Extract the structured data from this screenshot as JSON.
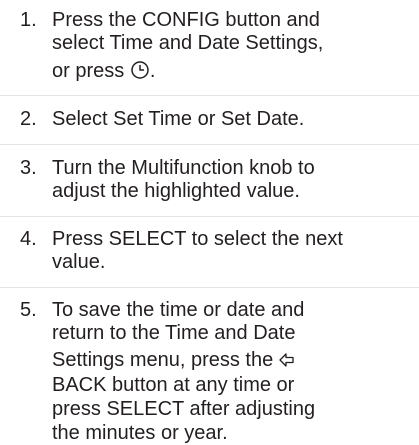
{
  "steps": [
    {
      "number": "1.",
      "line1": "Press the CONFIG button and",
      "line2": "select Time and Date Settings,",
      "line3_prefix": "or press ",
      "line3_suffix": ".",
      "icon": "clock-icon"
    },
    {
      "number": "2.",
      "line1": "Select Set Time or Set Date."
    },
    {
      "number": "3.",
      "line1": "Turn the Multifunction knob to",
      "line2": "adjust the highlighted value."
    },
    {
      "number": "4.",
      "line1": "Press SELECT to select the next",
      "line2": "value."
    },
    {
      "number": "5.",
      "line1": "To save the time or date and",
      "line2": "return to the Time and Date",
      "line3_prefix": "Settings menu, press the ",
      "line4": "BACK button at any time or",
      "line5": "press SELECT after adjusting",
      "line6": "the minutes or year.",
      "icon": "back-arrow-icon"
    }
  ]
}
